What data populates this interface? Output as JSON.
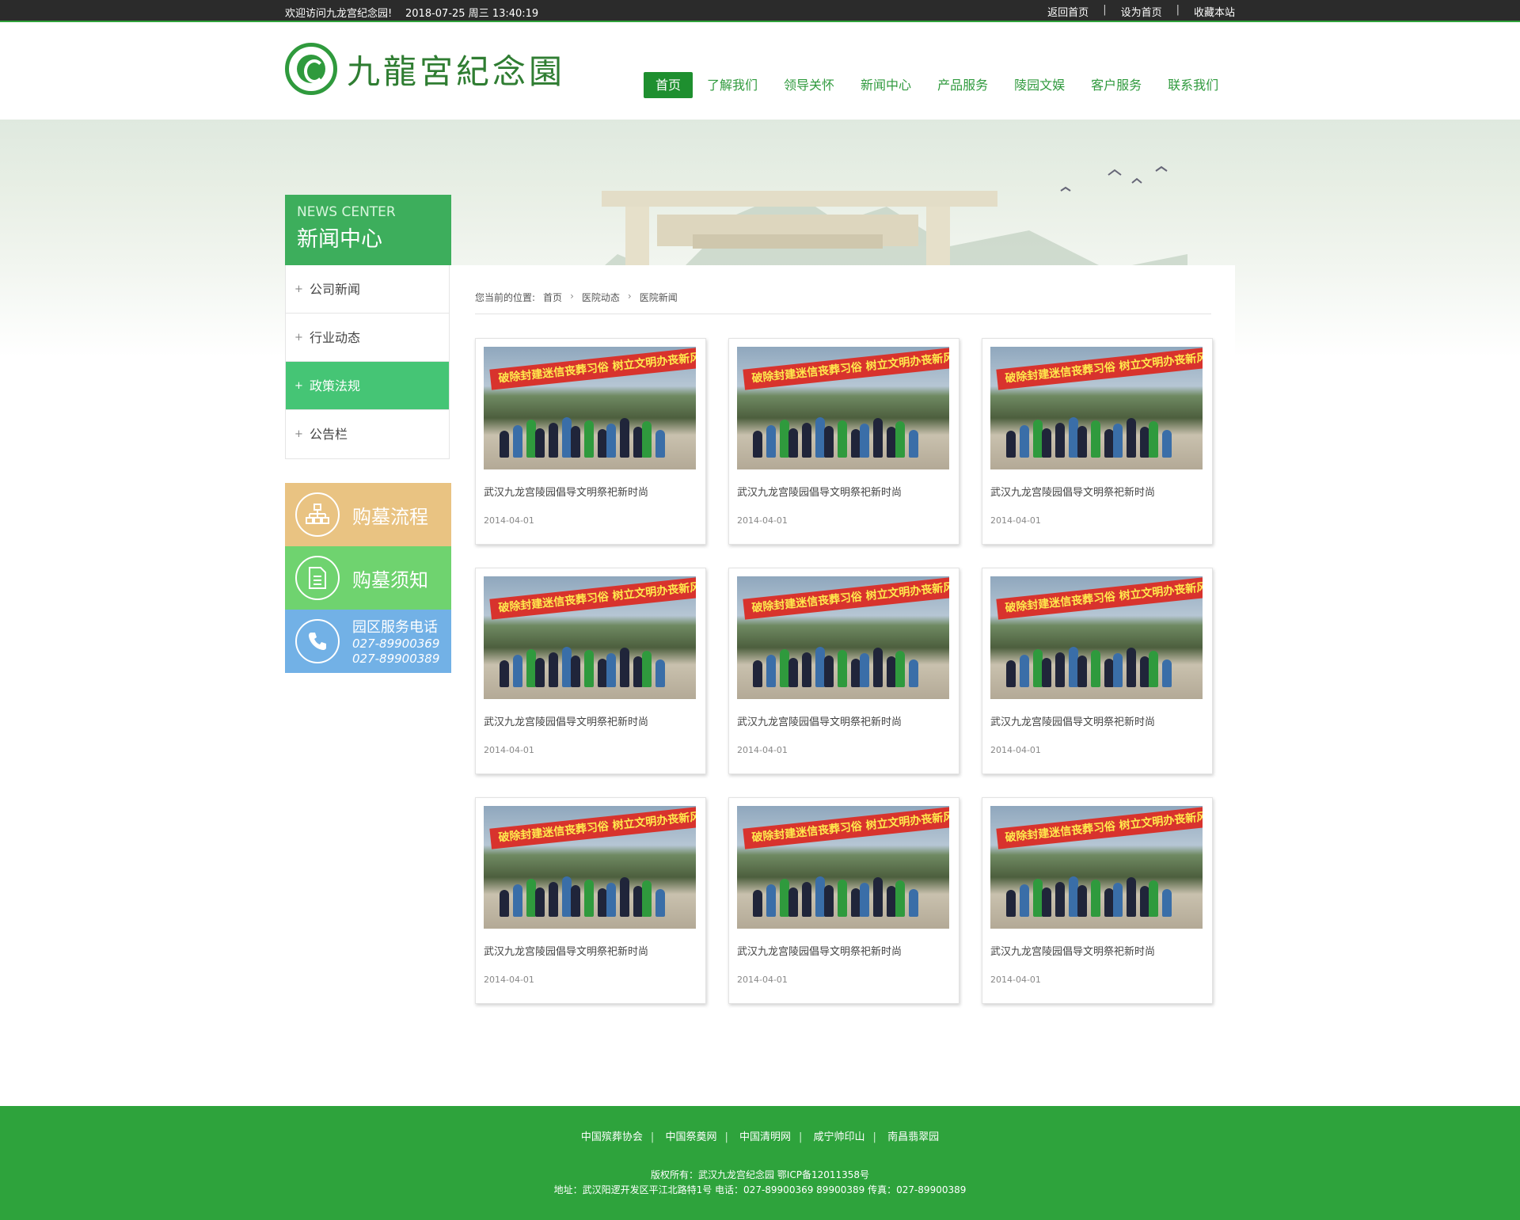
{
  "topbar": {
    "welcome": "欢迎访问九龙宫纪念园!",
    "datetime": "2018-07-25 周三 13:40:19",
    "links": [
      "返回首页",
      "设为首页",
      "收藏本站"
    ],
    "separator": "|"
  },
  "header": {
    "logo_text": "九龍宮紀念園",
    "nav": [
      "首页",
      "了解我们",
      "领导关怀",
      "新闻中心",
      "产品服务",
      "陵园文娱",
      "客户服务",
      "联系我们"
    ],
    "active_nav": "首页",
    "accent": "#1e8f2f"
  },
  "sidebar": {
    "en_title": "NEWS CENTER",
    "cn_title": "新闻中心",
    "items": [
      "公司新闻",
      "行业动态",
      "政策法规",
      "公告栏"
    ],
    "active_item": "政策法规",
    "quick": {
      "buy_process": "购墓流程",
      "buy_notice": "购墓须知",
      "phone_title": "园区服务电话",
      "phone1": "027-89900369",
      "phone2": "027-89900389"
    }
  },
  "breadcrumb": {
    "prefix": "您当前的位置:",
    "items": [
      "首页",
      "医院动态",
      "医院新闻"
    ]
  },
  "photo_banner_text": "破除封建迷信丧葬习俗  树立文明办丧新风",
  "news": [
    {
      "title": "武汉九龙宫陵园倡导文明祭祀新时尚",
      "date": "2014-04-01"
    },
    {
      "title": "武汉九龙宫陵园倡导文明祭祀新时尚",
      "date": "2014-04-01"
    },
    {
      "title": "武汉九龙宫陵园倡导文明祭祀新时尚",
      "date": "2014-04-01"
    },
    {
      "title": "武汉九龙宫陵园倡导文明祭祀新时尚",
      "date": "2014-04-01"
    },
    {
      "title": "武汉九龙宫陵园倡导文明祭祀新时尚",
      "date": "2014-04-01"
    },
    {
      "title": "武汉九龙宫陵园倡导文明祭祀新时尚",
      "date": "2014-04-01"
    },
    {
      "title": "武汉九龙宫陵园倡导文明祭祀新时尚",
      "date": "2014-04-01"
    },
    {
      "title": "武汉九龙宫陵园倡导文明祭祀新时尚",
      "date": "2014-04-01"
    },
    {
      "title": "武汉九龙宫陵园倡导文明祭祀新时尚",
      "date": "2014-04-01"
    }
  ],
  "footer": {
    "links": [
      "中国殡葬协会",
      "中国祭奠网",
      "中国清明网",
      "咸宁帅印山",
      "南昌翡翠园"
    ],
    "copyright": "版权所有：武汉九龙宫纪念园      鄂ICP备12011358号",
    "address": "地址：武汉阳逻开发区平江北路特1号      电话：027-89900369 89900389      传真：027-89900389",
    "bg": "#2ea33c"
  }
}
